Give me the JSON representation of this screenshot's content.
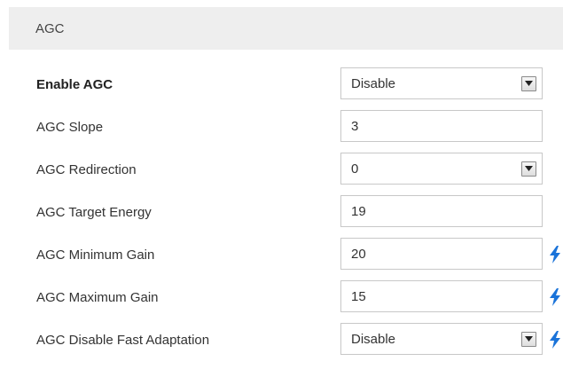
{
  "section": {
    "title": "AGC"
  },
  "accent_color": "#1a73d9",
  "fields": [
    {
      "label": "Enable AGC",
      "value": "Disable",
      "type": "select",
      "bold": true,
      "icon": ""
    },
    {
      "label": "AGC Slope",
      "value": "3",
      "type": "text",
      "icon": ""
    },
    {
      "label": "AGC Redirection",
      "value": "0",
      "type": "select",
      "icon": ""
    },
    {
      "label": "AGC Target Energy",
      "value": "19",
      "type": "text",
      "icon": ""
    },
    {
      "label": "AGC Minimum Gain",
      "value": "20",
      "type": "text",
      "icon": "lightning-bolt-icon"
    },
    {
      "label": "AGC Maximum Gain",
      "value": "15",
      "type": "text",
      "icon": "lightning-bolt-icon"
    },
    {
      "label": "AGC Disable Fast Adaptation",
      "value": "Disable",
      "type": "select",
      "icon": "lightning-bolt-icon"
    }
  ]
}
